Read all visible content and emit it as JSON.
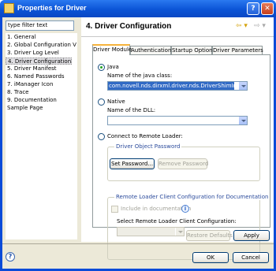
{
  "window": {
    "title": "Properties for Driver",
    "help_glyph": "?",
    "close_glyph": "✕"
  },
  "left": {
    "filter_placeholder": "type filter text",
    "tree": [
      "1. General",
      "2. Global Configuration V",
      "3. Driver Log Level",
      "4. Driver Configuration",
      "5. Driver Manifest",
      "6. Named Passwords",
      "7. iManager Icon",
      "8. Trace",
      "9. Documentation",
      "Sample Page"
    ],
    "selected_index": 3
  },
  "page": {
    "title": "4. Driver Configuration",
    "back_glyph": "⇦ ▾",
    "forward_glyph": "⇨ ▾",
    "tabs": [
      "Driver Module",
      "Authentication",
      "Startup Option",
      "Driver Parameters"
    ],
    "active_tab": 0,
    "java": {
      "label": "Java",
      "selected": true,
      "class_label": "Name of the java class:",
      "class_value": "com.novell.nds.dirxml.driver.nds.DriverShimImpl"
    },
    "native": {
      "label": "Native",
      "selected": false,
      "dll_label": "Name of the DLL:",
      "dll_value": ""
    },
    "remote": {
      "label": "Connect to Remote Loader:",
      "selected": false
    },
    "password_group": {
      "title": "Driver Object Password",
      "set_button": "Set Password...",
      "remove_button": "Remove Password"
    },
    "rl_group": {
      "title": "Remote Loader Client Configuration for Documentation",
      "include_label": "Include in documentation",
      "select_label": "Select Remote Loader Client Configuration:",
      "info_glyph": "i"
    },
    "restore_button": "Restore Defaults",
    "apply_button": "Apply"
  },
  "footer": {
    "help_glyph": "?",
    "ok_button": "OK",
    "cancel_button": "Cancel"
  },
  "colors": {
    "selection": "#316ac5",
    "tab_accent": "#f6b33b",
    "title_bar": "#0b54d6"
  }
}
